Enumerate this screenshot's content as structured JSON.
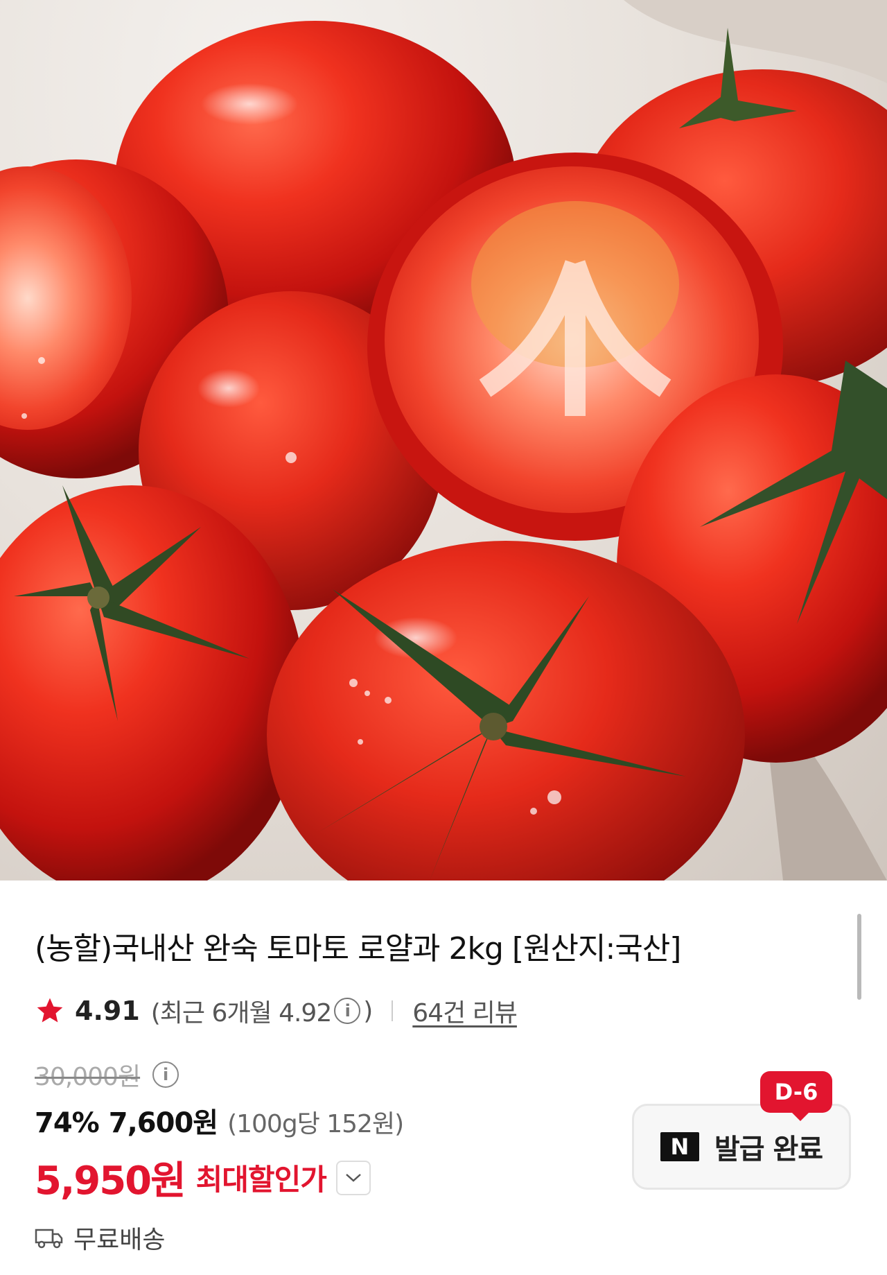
{
  "product": {
    "image_alt": "tomato product image",
    "title": "(농할)국내산 완숙 토마토 로얄과 2kg [원산지:국산]",
    "rating": {
      "value": "4.91",
      "recent": "(최근 6개월 4.92",
      "recent_close": ")",
      "info_glyph": "i",
      "reviews": "64건 리뷰"
    },
    "price": {
      "original": "30,000원",
      "discount_percent": "74%",
      "discounted": "7,600원",
      "unit_price": "(100g당 152원)",
      "max_discount_price": "5,950원",
      "max_discount_label": "최대할인가"
    },
    "shipping": {
      "label": "무료배송"
    },
    "coupon": {
      "badge": "D-6",
      "logo": "N",
      "label": "발급 완료"
    }
  },
  "colors": {
    "accent_red": "#e2152f",
    "text": "#111111",
    "muted": "#666666"
  },
  "icons": {
    "star": "star-icon",
    "info": "info-icon",
    "chevron": "chevron-down-icon",
    "truck": "truck-icon",
    "naver": "naver-n-icon"
  }
}
